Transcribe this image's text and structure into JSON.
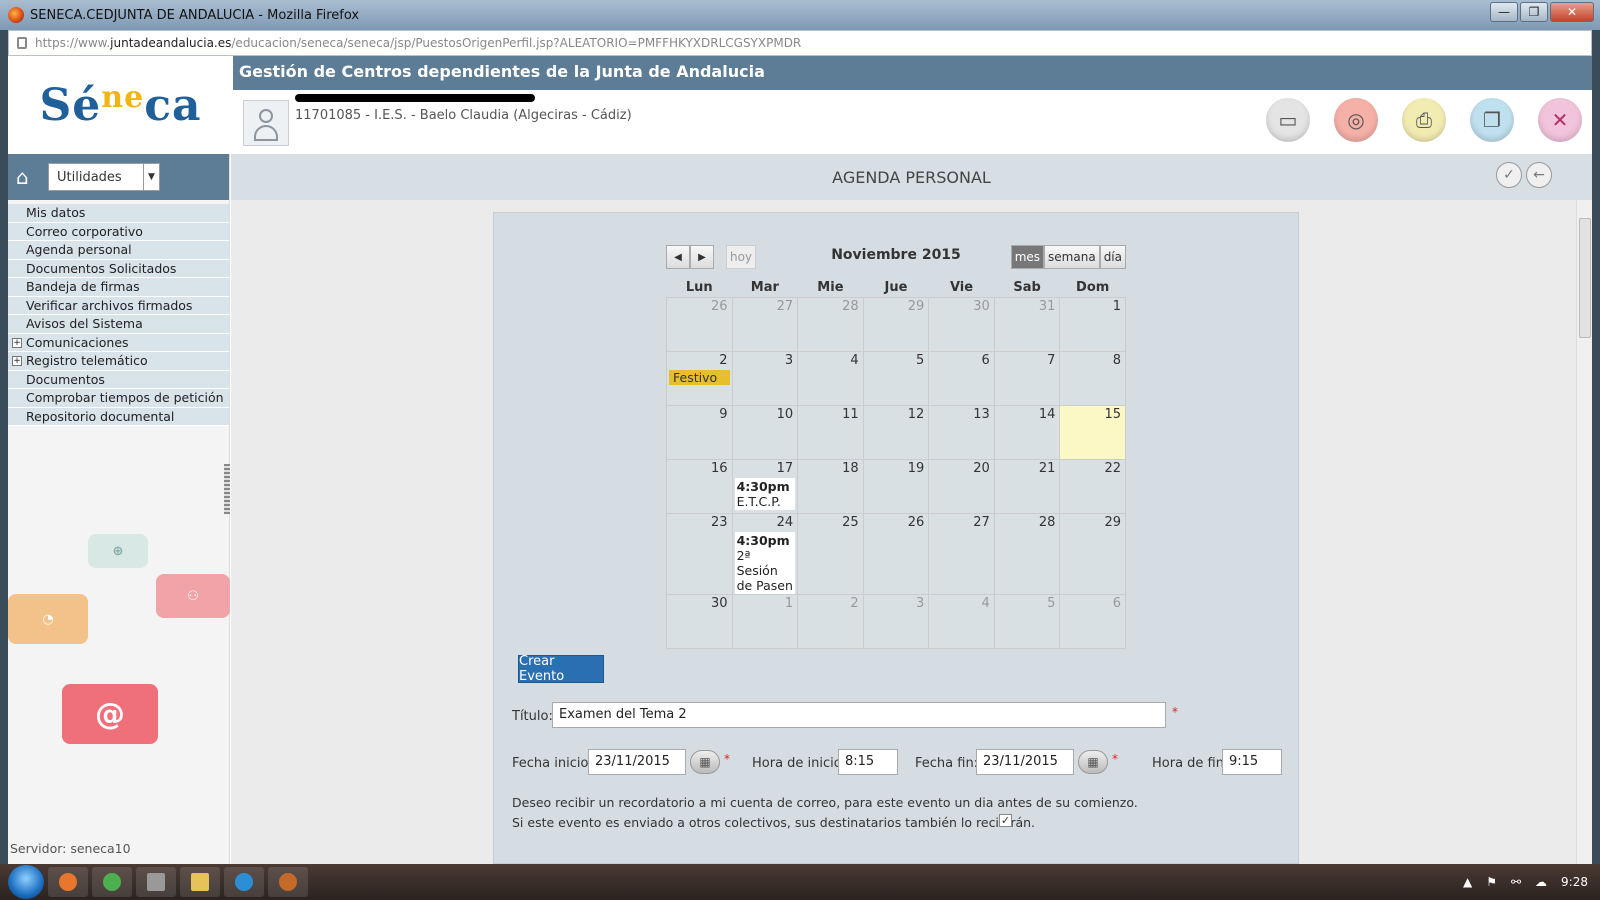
{
  "window": {
    "title": "SENECA.CEDJUNTA DE ANDALUCIA - Mozilla Firefox",
    "url_prefix": "https://www.",
    "url_domain": "juntadeandalucia.es",
    "url_rest": "/educacion/seneca/seneca/jsp/PuestosOrigenPerfil.jsp?ALEATORIO=PMFFHKYXDRLCGSYXPMDR"
  },
  "header": {
    "logo_left": "Sé",
    "logo_accent": "ne",
    "logo_right": "ca",
    "band_title": "Gestión de Centros dependientes de la Junta de Andalucia",
    "center": "11701085 - I.E.S. - Baelo Claudia (Algeciras - Cádiz)"
  },
  "sidebar": {
    "select_value": "Utilidades",
    "items": [
      {
        "label": "Mis datos"
      },
      {
        "label": "Correo corporativo"
      },
      {
        "label": "Agenda personal"
      },
      {
        "label": "Documentos Solicitados"
      },
      {
        "label": "Bandeja de firmas"
      },
      {
        "label": "Verificar archivos firmados"
      },
      {
        "label": "Avisos del Sistema"
      },
      {
        "label": "Comunicaciones"
      },
      {
        "label": "Registro telemático"
      },
      {
        "label": "Documentos"
      },
      {
        "label": "Comprobar tiempos de petición"
      },
      {
        "label": "Repositorio documental"
      }
    ],
    "server": "Servidor: seneca10"
  },
  "main": {
    "title": "AGENDA PERSONAL"
  },
  "calendar": {
    "today_label": "hoy",
    "month_title": "Noviembre 2015",
    "views": {
      "month": "mes",
      "week": "semana",
      "day": "día"
    },
    "weekdays": [
      "Lun",
      "Mar",
      "Mie",
      "Jue",
      "Vie",
      "Sab",
      "Dom"
    ],
    "weeks": [
      [
        "26",
        "27",
        "28",
        "29",
        "30",
        "31",
        "1"
      ],
      [
        "2",
        "3",
        "4",
        "5",
        "6",
        "7",
        "8"
      ],
      [
        "9",
        "10",
        "11",
        "12",
        "13",
        "14",
        "15"
      ],
      [
        "16",
        "17",
        "18",
        "19",
        "20",
        "21",
        "22"
      ],
      [
        "23",
        "24",
        "25",
        "26",
        "27",
        "28",
        "29"
      ],
      [
        "30",
        "1",
        "2",
        "3",
        "4",
        "5",
        "6"
      ]
    ],
    "events": {
      "festivo": "Festivo",
      "ev17_time": "4:30pm",
      "ev17_title": "E.T.C.P.",
      "ev24_time": "4:30pm",
      "ev24_title": "2ª Sesión de Pasen"
    }
  },
  "form": {
    "create_button": "Crear Evento",
    "title_label": "Título:",
    "title_value": "Examen del Tema 2",
    "start_date_label": "Fecha inicio:",
    "start_date_value": "23/11/2015",
    "start_time_label": "Hora de inicio:",
    "start_time_value": "8:15",
    "end_date_label": "Fecha fin:",
    "end_date_value": "23/11/2015",
    "end_time_label": "Hora de fin:",
    "end_time_value": "9:15",
    "reminder_note": "Deseo recibir un recordatorio a mi cuenta de correo, para este evento un dia antes de su comienzo.",
    "share_note": "Si este evento es enviado a otros colectivos, sus destinatarios también lo recibirán."
  },
  "taskbar": {
    "clock": "9:28"
  }
}
